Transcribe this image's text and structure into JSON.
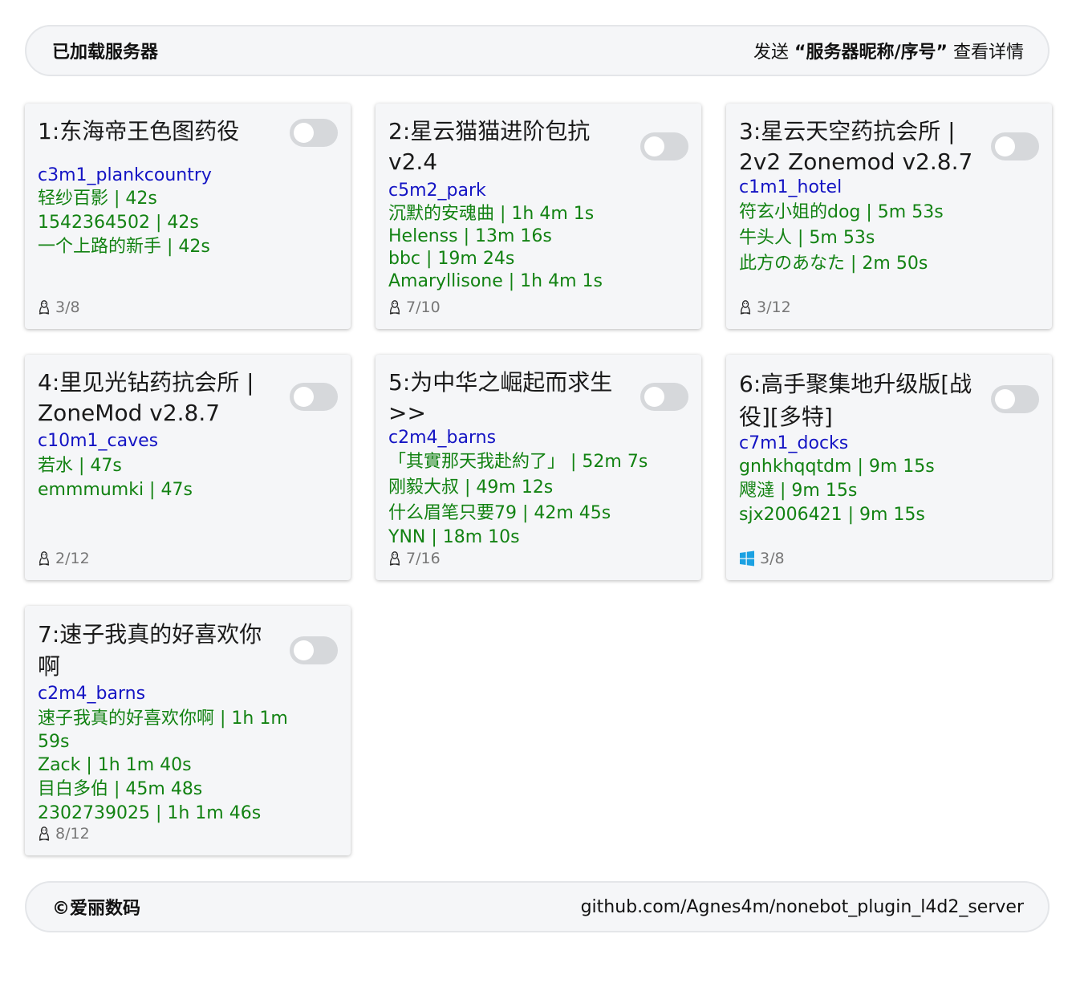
{
  "header": {
    "title": "已加载服务器",
    "hint_prefix": "发送",
    "hint_bold": "“服务器昵称/序号”",
    "hint_suffix": "查看详情"
  },
  "servers": [
    {
      "title_line1": "1:东海帝王色图药役",
      "title_line2": "",
      "map": "c3m1_plankcountry",
      "players": [
        "轻纱百影 | 42s",
        "1542364502 | 42s",
        "一个上路的新手 | 42s"
      ],
      "os_icon": "linux-icon",
      "count": "3/8",
      "enabled": false
    },
    {
      "title_line1": "2:星云猫猫进阶包抗",
      "title_line2": "v2.4",
      "map": "c5m2_park",
      "players": [
        "沉默的安魂曲 | 1h 4m 1s",
        "Helenss | 13m 16s",
        "bbc | 19m 24s",
        "Amaryllisone | 1h 4m 1s"
      ],
      "os_icon": "linux-icon",
      "count": "7/10",
      "enabled": false
    },
    {
      "title_line1": "3:星云天空药抗会所 |",
      "title_line2": "2v2 Zonemod v2.8.7",
      "map": "c1m1_hotel",
      "players": [
        "符玄小姐的dog | 5m 53s",
        "牛头人 | 5m 53s",
        "此方のあなた | 2m 50s"
      ],
      "os_icon": "linux-icon",
      "count": "3/12",
      "enabled": false
    },
    {
      "title_line1": "4:里见光钻药抗会所 |",
      "title_line2": "ZoneMod v2.8.7",
      "map": "c10m1_caves",
      "players": [
        "若水 | 47s",
        "emmmumki | 47s"
      ],
      "os_icon": "linux-icon",
      "count": "2/12",
      "enabled": false
    },
    {
      "title_line1": "5:为中华之崛起而求生",
      "title_line2": ">>",
      "map": "c2m4_barns",
      "players": [
        "「其實那天我赴約了」 | 52m 7s",
        "刚毅大叔 | 49m 12s",
        "什么眉笔只要79 | 42m 45s",
        "YNN | 18m 10s"
      ],
      "os_icon": "linux-icon",
      "count": "7/16",
      "enabled": false
    },
    {
      "title_line1": "6:高手聚集地升级版[战",
      "title_line2": "役][多特]",
      "map": "c7m1_docks",
      "players": [
        "gnhkhqqtdm | 9m 15s",
        "飕澾 | 9m 15s",
        "sjx2006421 | 9m 15s"
      ],
      "os_icon": "windows-icon",
      "count": "3/8",
      "enabled": false
    },
    {
      "title_line1": "7:速子我真的好喜欢你",
      "title_line2": "啊",
      "map": "c2m4_barns",
      "players": [
        "速子我真的好喜欢你啊 | 1h 1m",
        "59s",
        "Zack | 1h 1m 40s",
        "目白多伯 | 45m 48s",
        "2302739025 | 1h 1m 46s"
      ],
      "os_icon": "linux-icon",
      "count": "8/12",
      "enabled": false
    }
  ],
  "footer": {
    "copyright": "©爱丽数码",
    "link": "github.com/Agnes4m/nonebot_plugin_l4d2_server"
  }
}
